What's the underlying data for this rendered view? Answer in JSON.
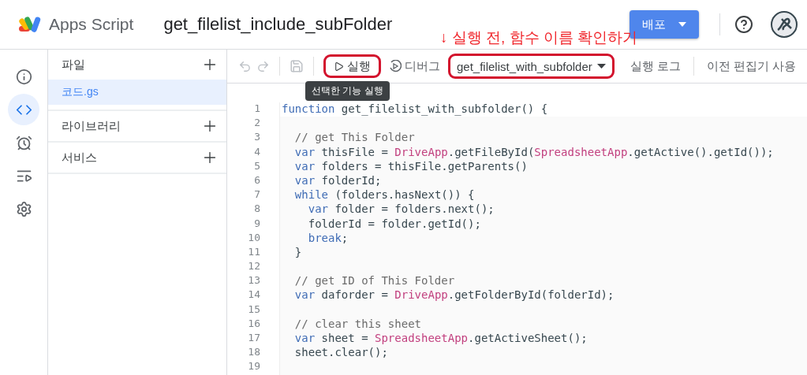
{
  "header": {
    "app_name": "Apps Script",
    "project_title": "get_filelist_include_subFolder",
    "deploy_button": "배포"
  },
  "annotation": "↓ 실행 전, 함수 이름 확인하기",
  "rail": [
    {
      "kind": "info",
      "selected": false
    },
    {
      "kind": "code",
      "selected": true
    },
    {
      "kind": "triggers",
      "selected": false
    },
    {
      "kind": "executions",
      "selected": false
    },
    {
      "kind": "settings",
      "selected": false
    }
  ],
  "files_panel": {
    "sections": [
      {
        "title": "파일",
        "files": [
          {
            "name": "코드.gs",
            "selected": true
          }
        ]
      },
      {
        "title": "라이브러리"
      },
      {
        "title": "서비스"
      }
    ]
  },
  "toolbar": {
    "run_button": {
      "label": "실행",
      "highlighted": true
    },
    "debug_button": {
      "label": "디버그"
    },
    "function_select": {
      "value": "get_filelist_with_subfolder",
      "highlighted": true
    },
    "log_button": "실행 로그",
    "legacy_button": "이전 편집기 사용",
    "tooltip": "선택한 기능 실행"
  },
  "code_lines": [
    {
      "number": "1",
      "tokens": [
        {
          "kind": "keyword",
          "text": "function"
        },
        {
          "kind": "plain",
          "text": " get_filelist_with_subfolder() {"
        }
      ]
    },
    {
      "number": "2"
    },
    {
      "number": "3",
      "tokens": [
        {
          "kind": "comment",
          "text": "  // get This Folder"
        }
      ]
    },
    {
      "number": "4",
      "tokens": [
        {
          "kind": "keyword",
          "text": "  var"
        },
        {
          "kind": "plain",
          "text": " thisFile = "
        },
        {
          "kind": "class",
          "text": "DriveApp"
        },
        {
          "kind": "plain",
          "text": ".getFileById("
        },
        {
          "kind": "class",
          "text": "SpreadsheetApp"
        },
        {
          "kind": "plain",
          "text": ".getActive().getId());"
        }
      ]
    },
    {
      "number": "5",
      "tokens": [
        {
          "kind": "keyword",
          "text": "  var"
        },
        {
          "kind": "plain",
          "text": " folders = thisFile.getParents()"
        }
      ]
    },
    {
      "number": "6",
      "tokens": [
        {
          "kind": "keyword",
          "text": "  var"
        },
        {
          "kind": "plain",
          "text": " folderId;"
        }
      ]
    },
    {
      "number": "7",
      "tokens": [
        {
          "kind": "keyword",
          "text": "  while"
        },
        {
          "kind": "plain",
          "text": " (folders.hasNext()) {"
        }
      ]
    },
    {
      "number": "8",
      "tokens": [
        {
          "kind": "keyword",
          "text": "    var"
        },
        {
          "kind": "plain",
          "text": " folder = folders.next();"
        }
      ]
    },
    {
      "number": "9",
      "tokens": [
        {
          "kind": "plain",
          "text": "    folderId = folder.getId();"
        }
      ]
    },
    {
      "number": "10",
      "tokens": [
        {
          "kind": "keyword",
          "text": "    break"
        },
        {
          "kind": "plain",
          "text": ";"
        }
      ]
    },
    {
      "number": "11",
      "tokens": [
        {
          "kind": "plain",
          "text": "  }"
        }
      ]
    },
    {
      "number": "12"
    },
    {
      "number": "13",
      "tokens": [
        {
          "kind": "comment",
          "text": "  // get ID of This Folder"
        }
      ]
    },
    {
      "number": "14",
      "tokens": [
        {
          "kind": "keyword",
          "text": "  var"
        },
        {
          "kind": "plain",
          "text": " daforder = "
        },
        {
          "kind": "class",
          "text": "DriveApp"
        },
        {
          "kind": "plain",
          "text": ".getFolderById(folderId);"
        }
      ]
    },
    {
      "number": "15"
    },
    {
      "number": "16",
      "tokens": [
        {
          "kind": "comment",
          "text": "  // clear this sheet"
        }
      ]
    },
    {
      "number": "17",
      "tokens": [
        {
          "kind": "keyword",
          "text": "  var"
        },
        {
          "kind": "plain",
          "text": " sheet = "
        },
        {
          "kind": "class",
          "text": "SpreadsheetApp"
        },
        {
          "kind": "plain",
          "text": ".getActiveSheet();"
        }
      ]
    },
    {
      "number": "18",
      "tokens": [
        {
          "kind": "plain",
          "text": "  sheet.clear();"
        }
      ]
    },
    {
      "number": "19"
    }
  ]
}
